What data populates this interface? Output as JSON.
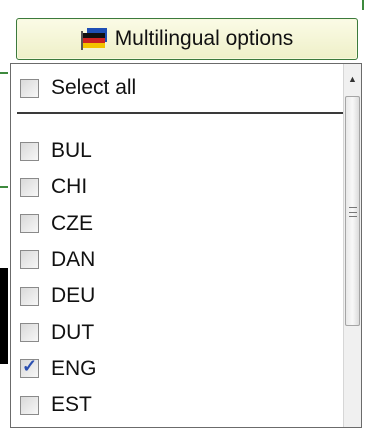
{
  "button": {
    "label": "Multilingual options",
    "icon": "flag-icon"
  },
  "select_all": {
    "label": "Select all",
    "checked": false
  },
  "languages": [
    {
      "code": "BUL",
      "checked": false
    },
    {
      "code": "CHI",
      "checked": false
    },
    {
      "code": "CZE",
      "checked": false
    },
    {
      "code": "DAN",
      "checked": false
    },
    {
      "code": "DEU",
      "checked": false
    },
    {
      "code": "DUT",
      "checked": false
    },
    {
      "code": "ENG",
      "checked": true
    },
    {
      "code": "EST",
      "checked": false
    }
  ],
  "scrollbar": {
    "up_arrow": "▲"
  },
  "colors": {
    "button_border": "#3c7a3c",
    "check": "#2b4fb0"
  }
}
